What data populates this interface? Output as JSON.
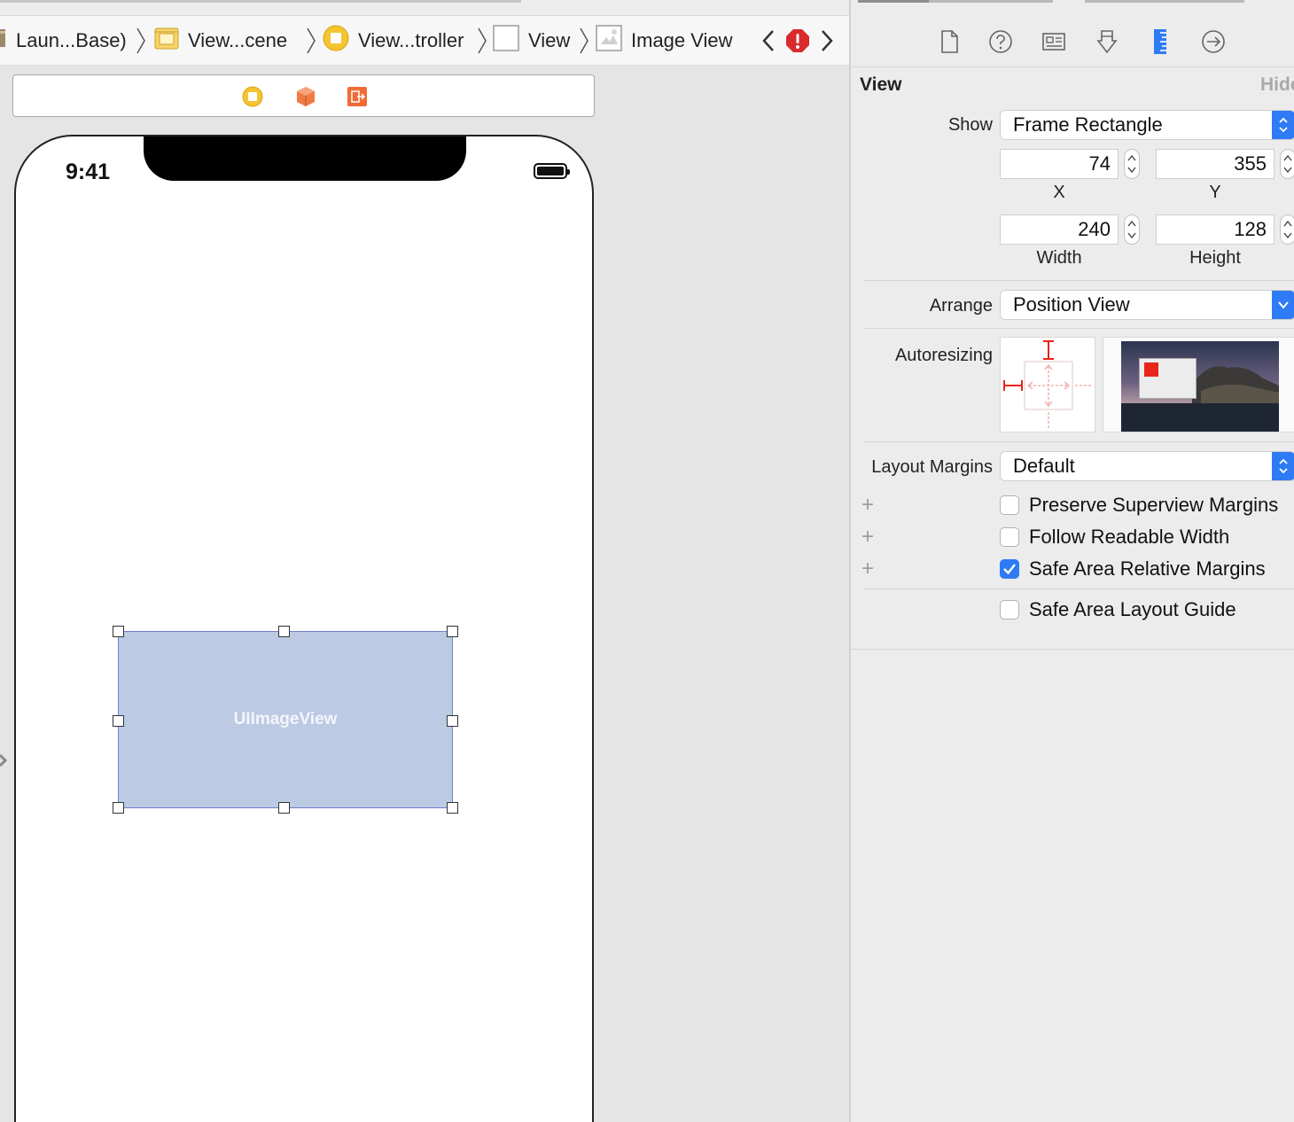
{
  "breadcrumb": {
    "items": [
      {
        "label": "Laun...Base)",
        "icon": "storyboard-icon"
      },
      {
        "label": "View...cene",
        "icon": "scene-icon"
      },
      {
        "label": "View...troller",
        "icon": "view-controller-icon"
      },
      {
        "label": "View",
        "icon": "view-icon"
      },
      {
        "label": "Image View",
        "icon": "image-view-icon"
      }
    ],
    "issue_icon": "error-icon"
  },
  "scene_dock": {
    "icons": [
      "view-controller-icon",
      "first-responder-icon",
      "exit-icon"
    ]
  },
  "device": {
    "status_time": "9:41"
  },
  "canvas": {
    "selected_view_label": "UIImageView"
  },
  "inspector": {
    "tabs": [
      "file-inspector-icon",
      "quick-help-icon",
      "identity-inspector-icon",
      "attributes-inspector-icon",
      "size-inspector-icon",
      "connections-inspector-icon"
    ],
    "active_tab": "size-inspector-icon",
    "section_title": "View",
    "hide_label": "Hide",
    "show": {
      "label": "Show",
      "value": "Frame Rectangle"
    },
    "frame": {
      "x": {
        "label": "X",
        "value": "74"
      },
      "y": {
        "label": "Y",
        "value": "355"
      },
      "width": {
        "label": "Width",
        "value": "240"
      },
      "height": {
        "label": "Height",
        "value": "128"
      }
    },
    "arrange": {
      "label": "Arrange",
      "value": "Position View"
    },
    "autoresizing": {
      "label": "Autoresizing"
    },
    "layout_margins": {
      "label": "Layout Margins",
      "value": "Default"
    },
    "checkboxes": [
      {
        "label": "Preserve Superview Margins",
        "checked": false
      },
      {
        "label": "Follow Readable Width",
        "checked": false
      },
      {
        "label": "Safe Area Relative Margins",
        "checked": true
      },
      {
        "label": "Safe Area Layout Guide",
        "checked": false
      }
    ]
  },
  "colors": {
    "accent": "#2f7bf5",
    "image_view_fill": "#bccae4",
    "error": "#d92b2b",
    "autoresize_red": "#e8251a"
  }
}
